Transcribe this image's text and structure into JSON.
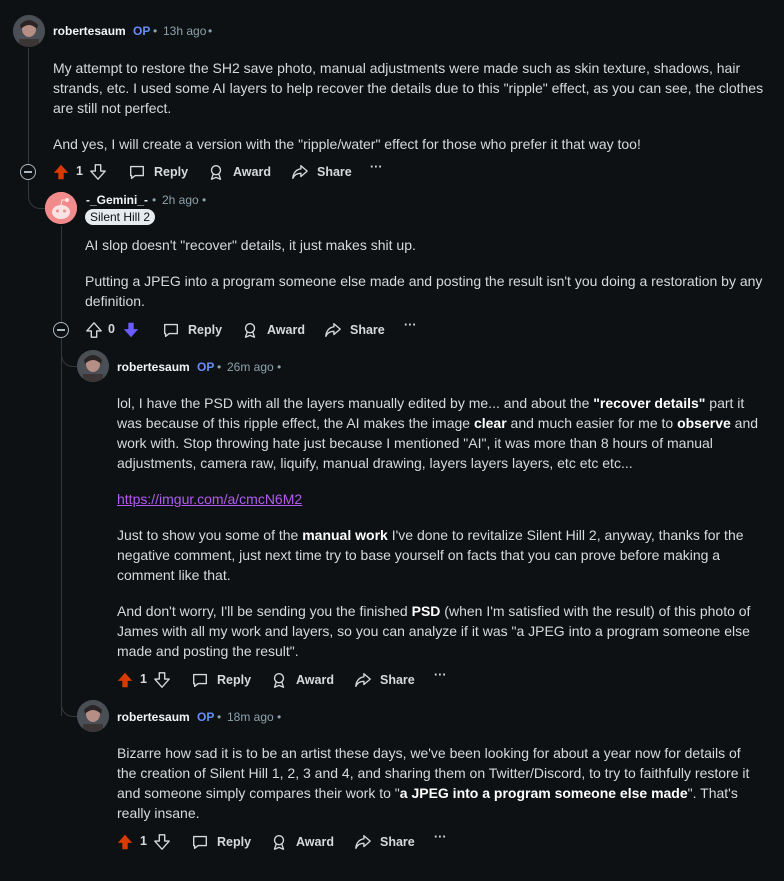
{
  "comments": [
    {
      "username": "robertesaum",
      "op": "OP",
      "time": "13h ago",
      "paragraphs": [
        "My attempt to restore the SH2 save photo, manual adjustments were made such as skin texture, shadows, hair strands, etc. I used some AI layers to help recover the details due to this \"ripple\" effect, as you can see, the clothes are still not perfect.",
        "And yes, I will create a version with the \"ripple/water\" effect for those who prefer it that way too!"
      ],
      "votes": "1"
    },
    {
      "username": "-_Gemini_-",
      "time": "2h ago",
      "flair": "Silent Hill 2",
      "paragraphs": [
        "AI slop doesn't \"recover\" details, it just makes shit up.",
        "Putting a JPEG into a program someone else made and posting the result isn't you doing a restoration by any definition."
      ],
      "votes": "0"
    },
    {
      "username": "robertesaum",
      "op": "OP",
      "time": "26m ago",
      "p1_a": "lol, I have the PSD with all the layers manually edited by me... and about the ",
      "p1_b": "\"recover details\"",
      "p1_c": " part it was because of this ripple effect, the AI makes the image ",
      "p1_d": "clear",
      "p1_e": " and much easier for me to ",
      "p1_f": "observe",
      "p1_g": " and work with. Stop throwing hate just because I mentioned \"AI\", it was more than 8 hours of manual adjustments, camera raw, liquify, manual drawing, layers layers layers, etc etc etc...",
      "link": "https://imgur.com/a/cmcN6M2",
      "p3_a": "Just to show you some of the ",
      "p3_b": "manual work",
      "p3_c": " I've done to revitalize Silent Hill 2, anyway, thanks for the negative comment, just next time try to base yourself on facts that you can prove before making a comment like that.",
      "p4_a": "And don't worry, I'll be sending you the finished ",
      "p4_b": "PSD",
      "p4_c": " (when I'm satisfied with the result) of this photo of James with all my work and layers, so you can analyze if it was \"a JPEG into a program someone else made and posting the result\".",
      "votes": "1"
    },
    {
      "username": "robertesaum",
      "op": "OP",
      "time": "18m ago",
      "p1_a": "Bizarre how sad it is to be an artist these days, we've been looking for about a year now for details of the creation of Silent Hill 1, 2, 3 and 4, and sharing them on Twitter/Discord, to try to faithfully restore it and someone simply compares their work to \"",
      "p1_b": "a JPEG into a program someone else made",
      "p1_c": "\". That's really insane.",
      "votes": "1"
    }
  ],
  "actions": {
    "reply": "Reply",
    "award": "Award",
    "share": "Share",
    "more": "···"
  },
  "colors": {
    "background": "#0e1113",
    "upvote_active": "#d93a00",
    "downvote_active": "#6a5cff",
    "op": "#648efc",
    "link": "#b05cf1"
  },
  "icons": [
    "collapse-icon",
    "upvote-icon",
    "downvote-icon",
    "reply-icon",
    "award-icon",
    "share-icon",
    "more-icon",
    "snoo-avatar-icon"
  ]
}
